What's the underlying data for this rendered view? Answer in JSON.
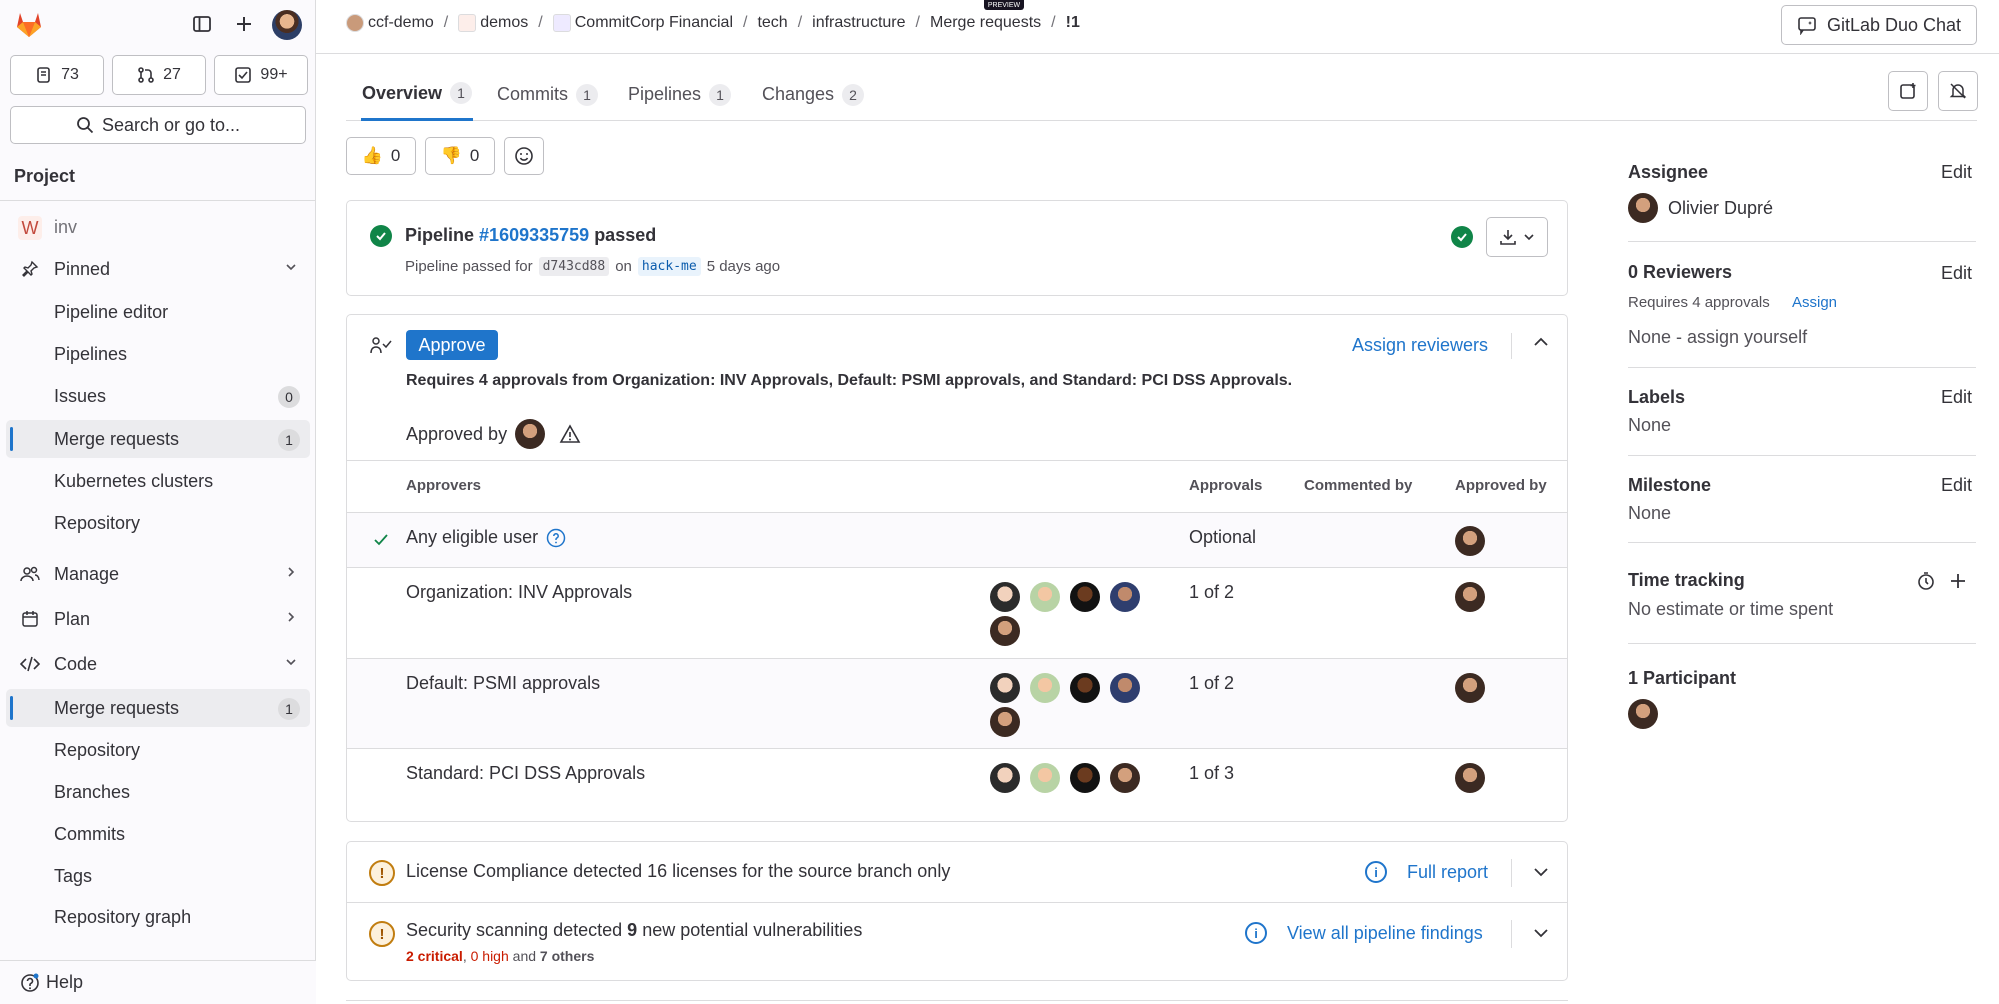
{
  "sidebar": {
    "counts": {
      "issues": "73",
      "merge_requests": "27",
      "todos": "99+"
    },
    "search_label": "Search or go to...",
    "section": "Project",
    "project_initial": "W",
    "project_name": "inv",
    "pinned": "Pinned",
    "pinned_items": [
      {
        "label": "Pipeline editor"
      },
      {
        "label": "Pipelines"
      },
      {
        "label": "Issues",
        "count": "0"
      },
      {
        "label": "Merge requests",
        "count": "1"
      },
      {
        "label": "Kubernetes clusters"
      },
      {
        "label": "Repository"
      }
    ],
    "manage": "Manage",
    "plan": "Plan",
    "code": "Code",
    "code_items": [
      {
        "label": "Merge requests",
        "count": "1"
      },
      {
        "label": "Repository"
      },
      {
        "label": "Branches"
      },
      {
        "label": "Commits"
      },
      {
        "label": "Tags"
      },
      {
        "label": "Repository graph"
      }
    ],
    "help": "Help"
  },
  "breadcrumbs": [
    "ccf-demo",
    "demos",
    "CommitCorp Financial",
    "tech",
    "infrastructure",
    "Merge requests",
    "!1"
  ],
  "preview_tag": "PREVIEW",
  "duo_chat": "GitLab Duo Chat",
  "tabs": [
    {
      "label": "Overview",
      "count": "1"
    },
    {
      "label": "Commits",
      "count": "1"
    },
    {
      "label": "Pipelines",
      "count": "1"
    },
    {
      "label": "Changes",
      "count": "2"
    }
  ],
  "reactions": {
    "thumbs_up": "0",
    "thumbs_down": "0"
  },
  "pipeline": {
    "prefix": "Pipeline",
    "id": "#1609335759",
    "status": "passed",
    "detail_prefix": "Pipeline passed for",
    "commit": "d743cd88",
    "on": "on",
    "branch": "hack-me",
    "time": "5 days ago"
  },
  "approval": {
    "button": "Approve",
    "assign_reviewers": "Assign reviewers",
    "requirement": "Requires 4 approvals from Organization: INV Approvals, Default: PSMI approvals, and Standard: PCI DSS Approvals.",
    "approved_by": "Approved by",
    "headers": {
      "approvers": "Approvers",
      "approvals": "Approvals",
      "commented_by": "Commented by",
      "approved_by": "Approved by"
    },
    "rows": [
      {
        "name": "Any eligible user",
        "approvals": "Optional"
      },
      {
        "name": "Organization: INV Approvals",
        "approvals": "1 of 2"
      },
      {
        "name": "Default: PSMI approvals",
        "approvals": "1 of 2"
      },
      {
        "name": "Standard: PCI DSS Approvals",
        "approvals": "1 of 3"
      }
    ]
  },
  "license": {
    "text": "License Compliance detected 16 licenses for the source branch only",
    "link": "Full report"
  },
  "security": {
    "text_prefix": "Security scanning detected",
    "count": "9",
    "text_suffix": "new potential vulnerabilities",
    "critical": "2 critical",
    "comma": ",",
    "high": "0 high",
    "and": "and",
    "others": "7 others",
    "link": "View all pipeline findings"
  },
  "right": {
    "assignee_title": "Assignee",
    "assignee_name": "Olivier Dupré",
    "edit": "Edit",
    "reviewers_title": "0 Reviewers",
    "requires": "Requires 4 approvals",
    "assign": "Assign",
    "none_assign": "None - assign yourself",
    "labels_title": "Labels",
    "labels_value": "None",
    "milestone_title": "Milestone",
    "milestone_value": "None",
    "time_title": "Time tracking",
    "time_value": "No estimate or time spent",
    "participants_title": "1 Participant"
  },
  "colors": {
    "accent": "#1f75cb",
    "success": "#108548",
    "danger": "#c91c00",
    "warning": "#c17d10"
  }
}
